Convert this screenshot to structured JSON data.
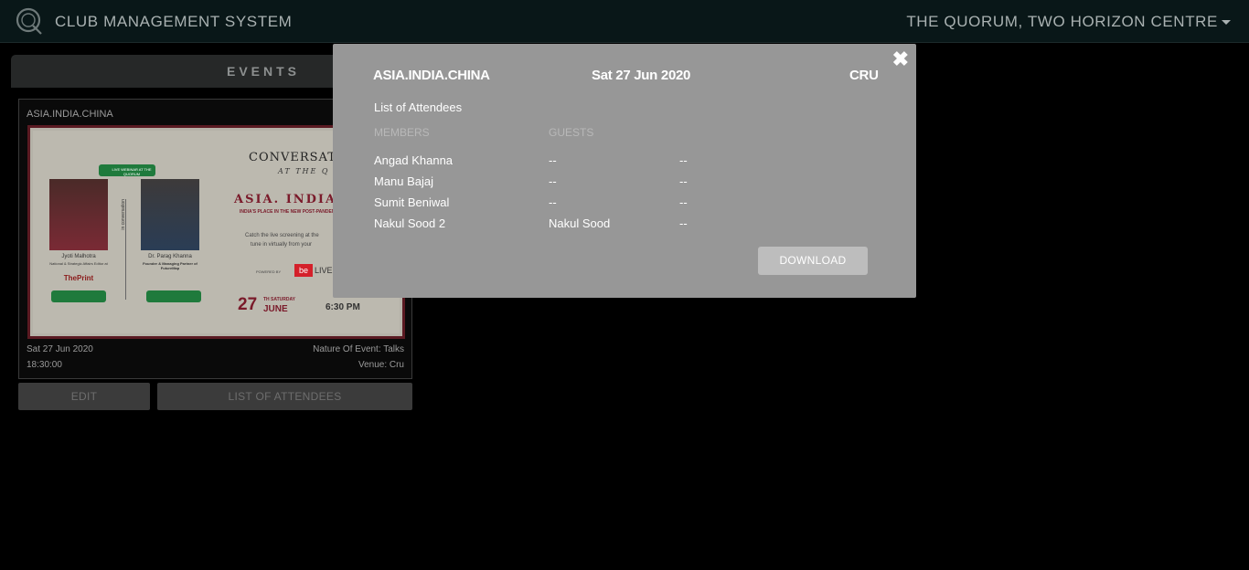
{
  "header": {
    "app_title": "CLUB MANAGEMENT SYSTEM",
    "club_name": "THE QUORUM, TWO HORIZON CENTRE"
  },
  "events": {
    "section_title": "EVENTS",
    "card": {
      "title": "ASIA.INDIA.CHINA",
      "poster": {
        "conversations": "CONVERSATIO",
        "at_the_q": "AT THE Q",
        "headline": "ASIA. INDIA. C",
        "subheadline": "INDIA'S PLACE IN THE NEW POST-PANDEM",
        "live_webinar": "LIVE WEBINAR AT THE QUORUM",
        "speaker1_name": "Jyoti Malhotra",
        "speaker1_role": "National & Strategic Affairs Editor at",
        "speaker1_org": "ThePrint",
        "speaker2_name": "Dr. Parag Khanna",
        "speaker2_role": "Founder & Managing Partner of FutureMap",
        "in_conversation": "in conversation",
        "catch_line": "Catch the live screening at the",
        "tune_line": "tune in virtually from your",
        "powered_by": "POWERED BY",
        "be_live": "be",
        "live": "LIVE",
        "day": "27",
        "day_suffix": "TH SATURDAY",
        "month": "JUNE",
        "time": "6:30 PM"
      },
      "date": "Sat 27 Jun 2020",
      "time": "18:30:00",
      "nature": "Nature Of Event: Talks",
      "venue": "Venue: Cru"
    },
    "edit_label": "EDIT",
    "list_label": "LIST OF ATTENDEES"
  },
  "modal": {
    "event_name": "ASIA.INDIA.CHINA",
    "date": "Sat 27 Jun 2020",
    "venue": "CRU",
    "close_glyph": "✖",
    "list_title": "List of Attendees",
    "col_members": "MEMBERS",
    "col_guests": "GUESTS",
    "rows": [
      {
        "member": "Angad Khanna",
        "guest": "--",
        "extra": "--"
      },
      {
        "member": "Manu Bajaj",
        "guest": "--",
        "extra": "--"
      },
      {
        "member": "Sumit Beniwal",
        "guest": "--",
        "extra": "--"
      },
      {
        "member": "Nakul Sood 2",
        "guest": "Nakul Sood",
        "extra": "--"
      }
    ],
    "download_label": "DOWNLOAD"
  }
}
